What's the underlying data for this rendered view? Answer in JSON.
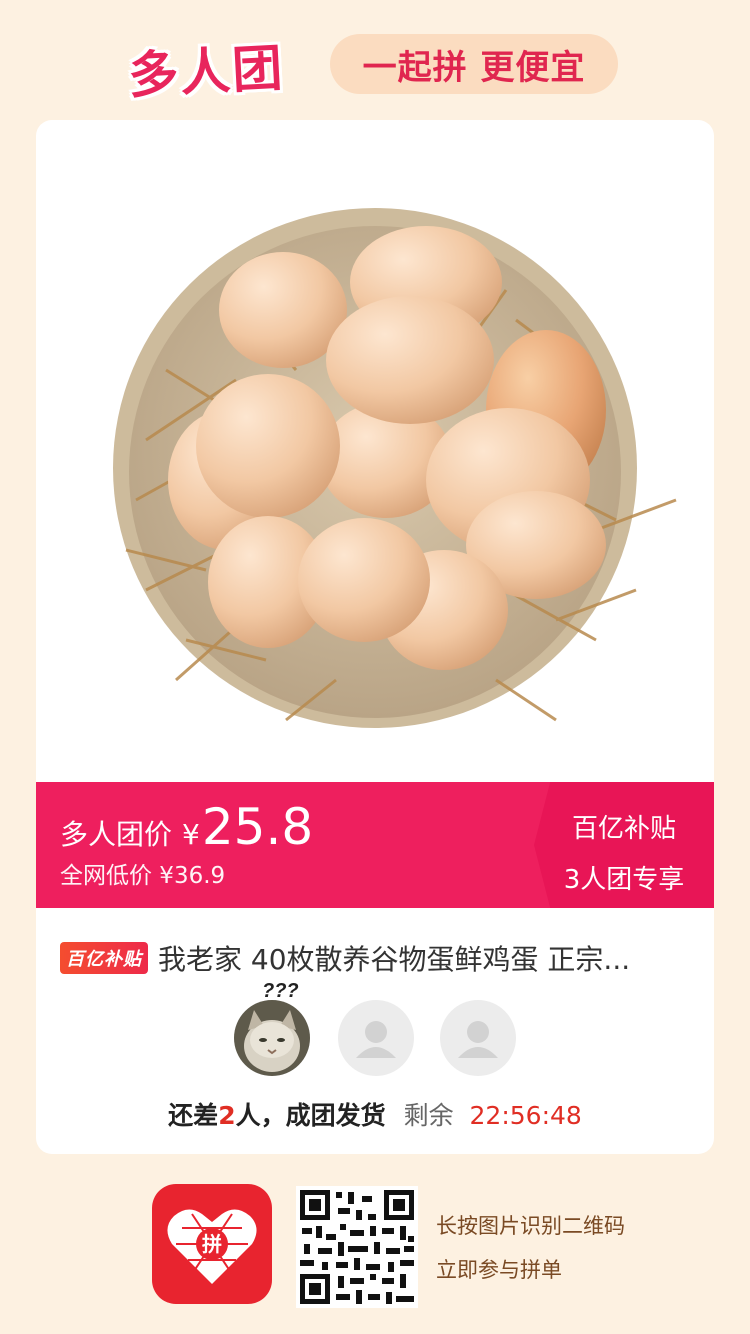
{
  "header": {
    "brand": "多人团",
    "slogan": "一起拼 更便宜"
  },
  "product": {
    "image_alt": "eggs-in-bowl",
    "price_label": "多人团价",
    "currency": "¥",
    "price": "25.8",
    "original_price_text": "全网低价 ¥36.9",
    "subsidy_title": "百亿补贴",
    "subsidy_sub": "3人团专享",
    "tag": "百亿补贴",
    "title": "我老家 40枚散养谷物蛋鲜鸡蛋 正宗..."
  },
  "group": {
    "question_marks": "???",
    "status_prefix": "还差",
    "missing_count": "2",
    "status_suffix": "人，成团发货",
    "remain_label": "剩余",
    "countdown": "22:56:48"
  },
  "footer": {
    "app_icon": "pinduoduo-logo",
    "app_icon_text": "拼",
    "line1": "长按图片识别二维码",
    "line2": "立即参与拼单"
  },
  "colors": {
    "accent": "#ee1f5e",
    "price_red": "#e02e24",
    "background": "#fdf1e1"
  }
}
